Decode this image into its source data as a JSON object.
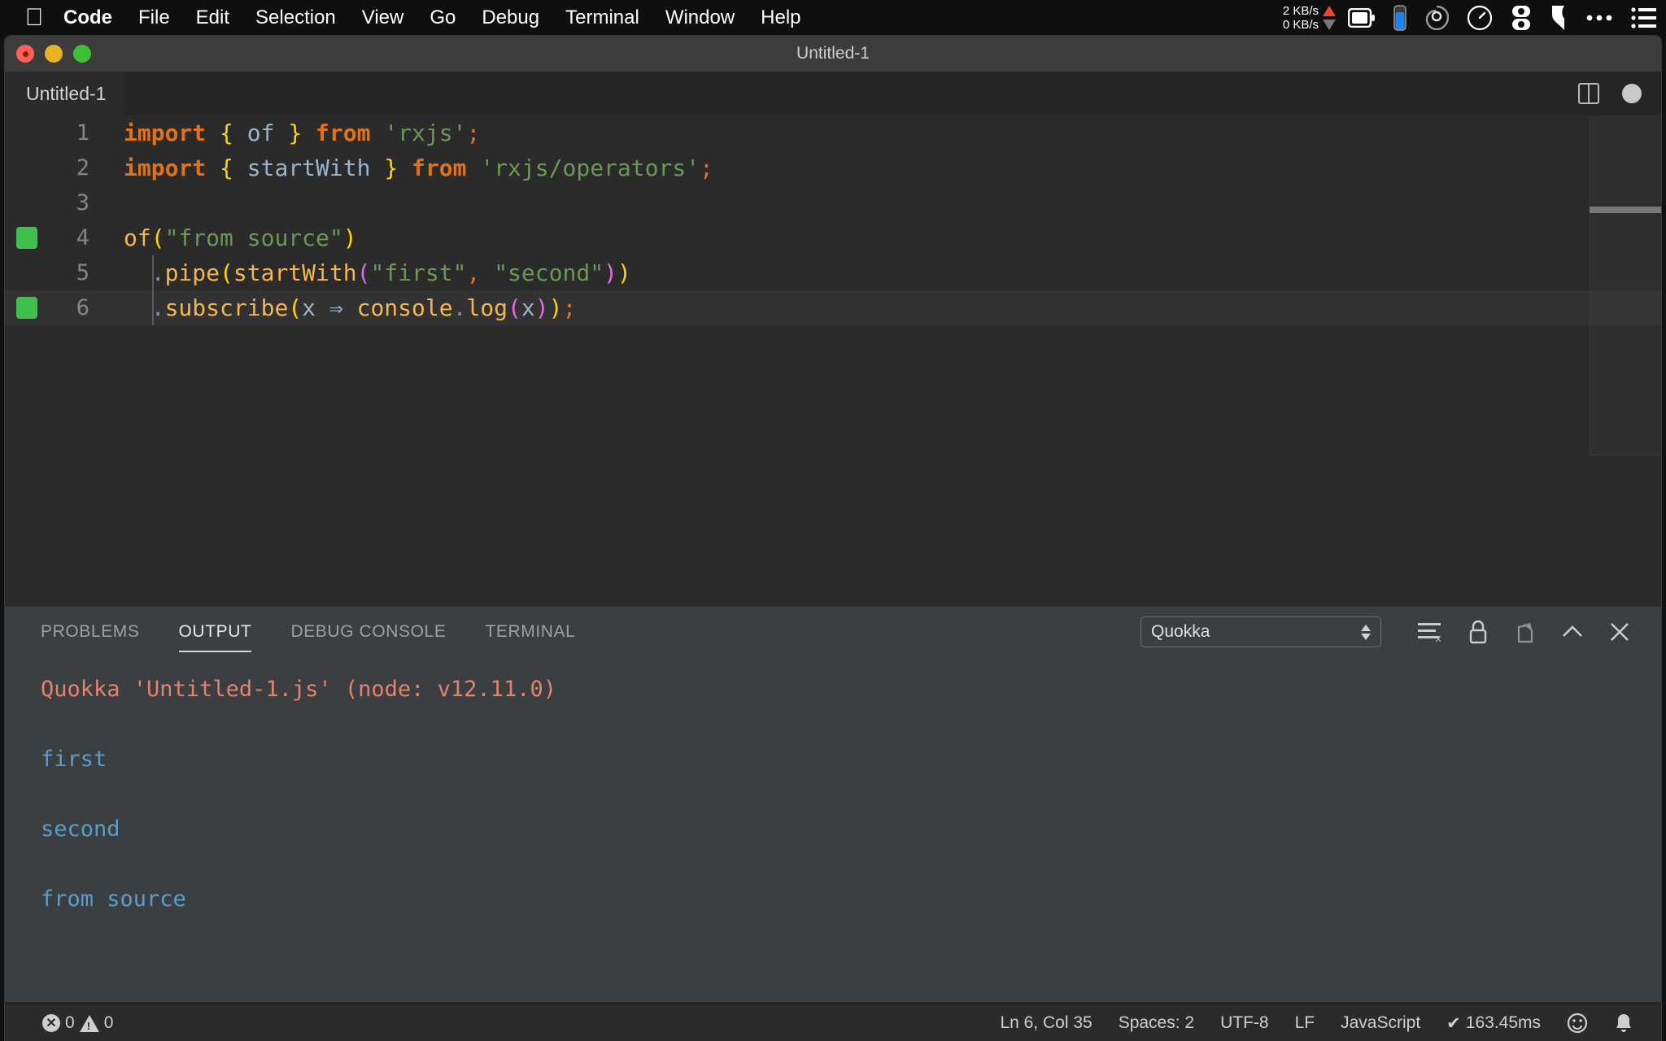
{
  "menubar": {
    "apple_icon": "apple-logo-icon",
    "items": [
      {
        "label": "Code",
        "bold": true
      },
      {
        "label": "File",
        "bold": false
      },
      {
        "label": "Edit",
        "bold": false
      },
      {
        "label": "Selection",
        "bold": false
      },
      {
        "label": "View",
        "bold": false
      },
      {
        "label": "Go",
        "bold": false
      },
      {
        "label": "Debug",
        "bold": false
      },
      {
        "label": "Terminal",
        "bold": false
      },
      {
        "label": "Window",
        "bold": false
      },
      {
        "label": "Help",
        "bold": false
      }
    ],
    "network": {
      "upload": "2 KB/s",
      "download": "0 KB/s",
      "upload_color": "#f04038",
      "download_color": "#8c8c8c"
    },
    "tray_icons": [
      "battery-icon",
      "battery-level-icon",
      "cloud-sync-icon",
      "speedometer-icon",
      "toggle-switches-icon",
      "flag-icon",
      "ellipsis-icon",
      "control-center-list-icon"
    ]
  },
  "window": {
    "title": "Untitled-1",
    "traffic_lights": [
      "close-button",
      "minimize-button",
      "maximize-button"
    ]
  },
  "editor": {
    "tab": {
      "label": "Untitled-1",
      "dirty": true
    },
    "actions": [
      "split-editor-icon",
      "unsaved-indicator-icon"
    ],
    "lines": [
      {
        "num": "1",
        "coverage": false,
        "highlight": false,
        "indent_guide": false,
        "tokens": [
          {
            "t": "import",
            "c": "t-keyword"
          },
          {
            "t": " ",
            "c": "t-plain"
          },
          {
            "t": "{",
            "c": "t-brace"
          },
          {
            "t": " ",
            "c": "t-plain"
          },
          {
            "t": "of",
            "c": "t-var"
          },
          {
            "t": " ",
            "c": "t-plain"
          },
          {
            "t": "}",
            "c": "t-brace"
          },
          {
            "t": " ",
            "c": "t-plain"
          },
          {
            "t": "from",
            "c": "t-keyword"
          },
          {
            "t": " ",
            "c": "t-plain"
          },
          {
            "t": "'rxjs'",
            "c": "t-string"
          },
          {
            "t": ";",
            "c": "t-punc"
          }
        ]
      },
      {
        "num": "2",
        "coverage": false,
        "highlight": false,
        "indent_guide": false,
        "tokens": [
          {
            "t": "import",
            "c": "t-keyword"
          },
          {
            "t": " ",
            "c": "t-plain"
          },
          {
            "t": "{",
            "c": "t-brace"
          },
          {
            "t": " ",
            "c": "t-plain"
          },
          {
            "t": "startWith",
            "c": "t-var"
          },
          {
            "t": " ",
            "c": "t-plain"
          },
          {
            "t": "}",
            "c": "t-brace"
          },
          {
            "t": " ",
            "c": "t-plain"
          },
          {
            "t": "from",
            "c": "t-keyword"
          },
          {
            "t": " ",
            "c": "t-plain"
          },
          {
            "t": "'rxjs/operators'",
            "c": "t-string"
          },
          {
            "t": ";",
            "c": "t-punc"
          }
        ]
      },
      {
        "num": "3",
        "coverage": false,
        "highlight": false,
        "indent_guide": false,
        "tokens": []
      },
      {
        "num": "4",
        "coverage": true,
        "highlight": false,
        "indent_guide": false,
        "tokens": [
          {
            "t": "of",
            "c": "t-func"
          },
          {
            "t": "(",
            "c": "t-paren-y"
          },
          {
            "t": "\"from source\"",
            "c": "t-string"
          },
          {
            "t": ")",
            "c": "t-paren-y"
          }
        ]
      },
      {
        "num": "5",
        "coverage": false,
        "highlight": false,
        "indent_guide": true,
        "tokens": [
          {
            "t": "  ",
            "c": "t-plain"
          },
          {
            "t": ".",
            "c": "t-dotdim"
          },
          {
            "t": "pipe",
            "c": "t-func"
          },
          {
            "t": "(",
            "c": "t-paren-y"
          },
          {
            "t": "startWith",
            "c": "t-func"
          },
          {
            "t": "(",
            "c": "t-paren-m"
          },
          {
            "t": "\"first\"",
            "c": "t-string"
          },
          {
            "t": ",",
            "c": "t-punc"
          },
          {
            "t": " ",
            "c": "t-plain"
          },
          {
            "t": "\"second\"",
            "c": "t-string"
          },
          {
            "t": ")",
            "c": "t-paren-m"
          },
          {
            "t": ")",
            "c": "t-paren-y"
          }
        ]
      },
      {
        "num": "6",
        "coverage": true,
        "highlight": true,
        "indent_guide": true,
        "tokens": [
          {
            "t": "  ",
            "c": "t-plain"
          },
          {
            "t": ".",
            "c": "t-dotdim"
          },
          {
            "t": "subscribe",
            "c": "t-func"
          },
          {
            "t": "(",
            "c": "t-paren-y"
          },
          {
            "t": "x",
            "c": "t-var"
          },
          {
            "t": " ⇒ ",
            "c": "t-var"
          },
          {
            "t": "console",
            "c": "t-func"
          },
          {
            "t": ".",
            "c": "t-dotdim"
          },
          {
            "t": "log",
            "c": "t-func"
          },
          {
            "t": "(",
            "c": "t-paren-m"
          },
          {
            "t": "x",
            "c": "t-var"
          },
          {
            "t": ")",
            "c": "t-paren-m"
          },
          {
            "t": ")",
            "c": "t-paren-y"
          },
          {
            "t": ";",
            "c": "t-punc"
          }
        ]
      }
    ]
  },
  "panel": {
    "tabs": [
      {
        "label": "PROBLEMS",
        "active": false
      },
      {
        "label": "OUTPUT",
        "active": true
      },
      {
        "label": "DEBUG CONSOLE",
        "active": false
      },
      {
        "label": "TERMINAL",
        "active": false
      }
    ],
    "channel_select": {
      "value": "Quokka"
    },
    "actions": [
      "clear-output-icon",
      "scroll-lock-icon",
      "open-in-editor-icon",
      "collapse-panel-icon",
      "close-panel-icon"
    ],
    "output": [
      {
        "text": "Quokka 'Untitled-1.js' (node: v12.11.0)",
        "kind": "head"
      },
      {
        "text": "",
        "kind": "blank"
      },
      {
        "text": "first",
        "kind": "val"
      },
      {
        "text": "",
        "kind": "blank"
      },
      {
        "text": "second",
        "kind": "val"
      },
      {
        "text": "",
        "kind": "blank"
      },
      {
        "text": "from source",
        "kind": "val"
      }
    ]
  },
  "statusbar": {
    "errors": "0",
    "warnings": "0",
    "cursor": "Ln 6, Col 35",
    "indentation": "Spaces: 2",
    "encoding": "UTF-8",
    "eol": "LF",
    "language": "JavaScript",
    "quokka_time": "163.45ms",
    "quokka_check": "✔",
    "feedback_icon": "smiley-icon",
    "notifications_icon": "bell-icon"
  },
  "colors": {
    "accent_green": "#3fbf4b",
    "output_head": "#e2836c",
    "output_value": "#5b9dc9",
    "string": "#6a9955",
    "keyword": "#e2711a"
  }
}
